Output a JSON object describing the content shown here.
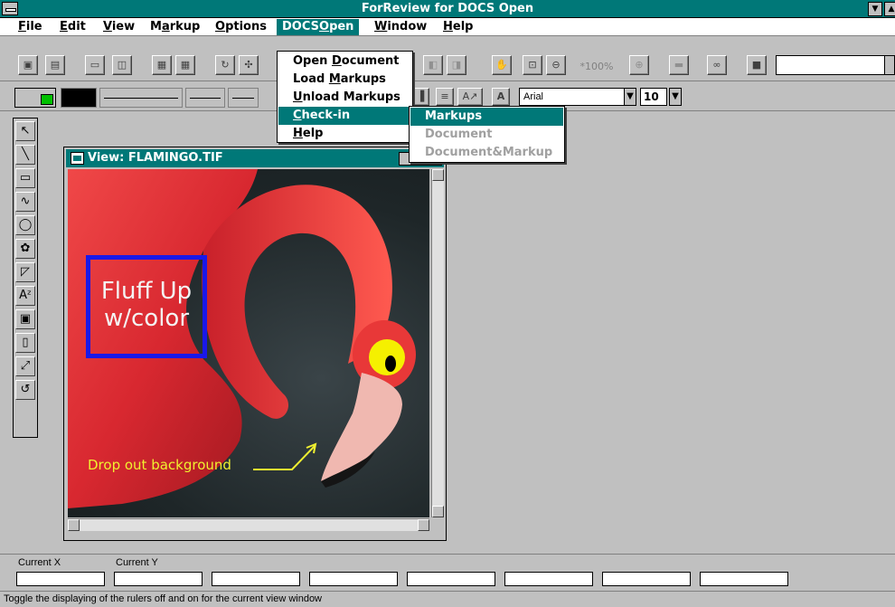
{
  "app": {
    "title": "ForReview for DOCS Open"
  },
  "menubar": [
    {
      "id": "file",
      "pre": "",
      "ul": "F",
      "post": "ile"
    },
    {
      "id": "edit",
      "pre": "",
      "ul": "E",
      "post": "dit"
    },
    {
      "id": "view",
      "pre": "",
      "ul": "V",
      "post": "iew"
    },
    {
      "id": "markup",
      "pre": "M",
      "ul": "a",
      "post": "rkup"
    },
    {
      "id": "options",
      "pre": "",
      "ul": "O",
      "post": "ptions"
    },
    {
      "id": "docsopen",
      "pre": "DOCS",
      "ul": "O",
      "post": "pen"
    },
    {
      "id": "window",
      "pre": "",
      "ul": "W",
      "post": "indow"
    },
    {
      "id": "help",
      "pre": "",
      "ul": "H",
      "post": "elp"
    }
  ],
  "docs_menu": [
    {
      "pre": "Open ",
      "ul": "D",
      "post": "ocument"
    },
    {
      "pre": "Load ",
      "ul": "M",
      "post": "arkups"
    },
    {
      "pre": "",
      "ul": "U",
      "post": "nload Markups"
    },
    {
      "pre": "",
      "ul": "C",
      "post": "heck-in"
    },
    {
      "pre": "",
      "ul": "H",
      "post": "elp"
    }
  ],
  "checkin_submenu": [
    {
      "label": "Markups",
      "enabled": true
    },
    {
      "label": "Document",
      "enabled": false
    },
    {
      "label": "Document&Markup",
      "enabled": false
    }
  ],
  "toolbar": {
    "zoom": "*100%",
    "font": "Arial",
    "font_size": "10"
  },
  "doc_window": {
    "title": "View: FLAMINGO.TIF",
    "annotations": {
      "fluff_line1": "Fluff Up",
      "fluff_line2": "w/color",
      "drop": "Drop out background"
    }
  },
  "coords": {
    "x_label": "Current X",
    "y_label": "Current Y"
  },
  "status": {
    "text": "Toggle the displaying of the rulers off and on for the current view window"
  },
  "colors": {
    "accent": "#007878",
    "box_blue": "#1a18e8",
    "eye_yellow": "#f5f000",
    "note_yellow": "#f0f030"
  }
}
